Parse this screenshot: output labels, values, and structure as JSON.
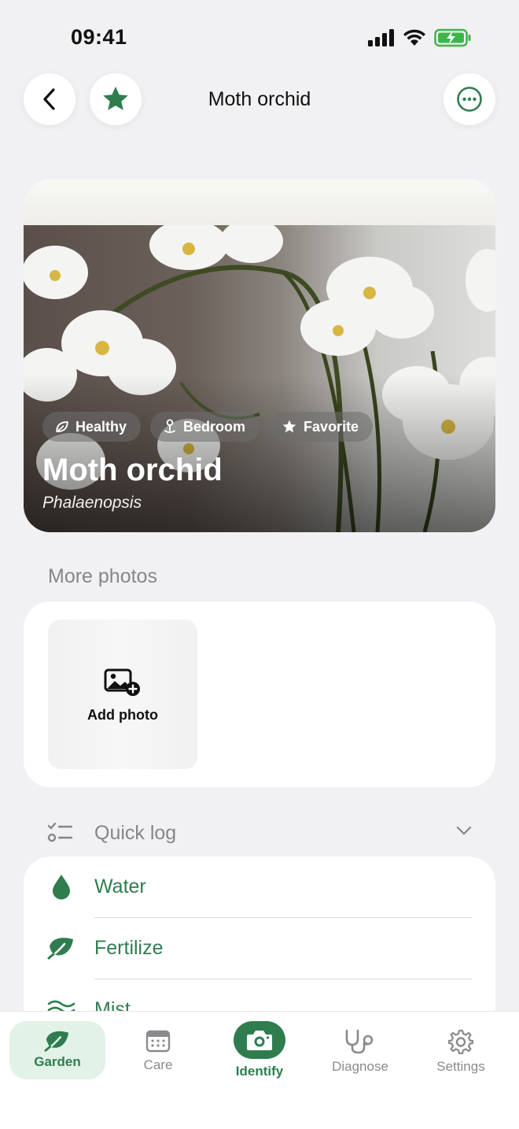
{
  "status_bar": {
    "time": "09:41"
  },
  "header": {
    "title": "Moth orchid",
    "back_icon": "chevron-left-icon",
    "favorite_icon": "star-icon",
    "more_icon": "ellipsis-circle-icon"
  },
  "hero": {
    "name": "Moth orchid",
    "scientific_name": "Phalaenopsis",
    "chips": [
      {
        "label": "Healthy",
        "icon": "leaf-icon"
      },
      {
        "label": "Bedroom",
        "icon": "location-pin-icon"
      },
      {
        "label": "Favorite",
        "icon": "star-icon"
      }
    ]
  },
  "more_photos": {
    "title": "More photos",
    "add_photo_label": "Add photo"
  },
  "quick_log": {
    "title": "Quick log",
    "items": [
      {
        "label": "Water",
        "icon": "water-drop-icon"
      },
      {
        "label": "Fertilize",
        "icon": "leaf-icon"
      },
      {
        "label": "Mist",
        "icon": "mist-icon"
      }
    ]
  },
  "tab_bar": {
    "tabs": [
      {
        "label": "Garden",
        "active": true
      },
      {
        "label": "Care",
        "active": false
      },
      {
        "label": "Identify",
        "active": false
      },
      {
        "label": "Diagnose",
        "active": false
      },
      {
        "label": "Settings",
        "active": false
      }
    ]
  },
  "colors": {
    "accent_green": "#2f7d4f",
    "active_tab_bg": "#e3f2e7",
    "background": "#f1f1f3"
  }
}
